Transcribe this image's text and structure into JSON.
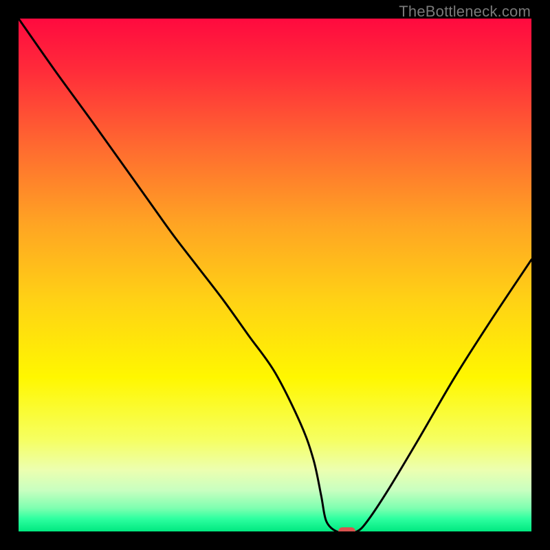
{
  "watermark": "TheBottleneck.com",
  "chart_data": {
    "type": "line",
    "title": "",
    "xlabel": "",
    "ylabel": "",
    "xlim": [
      0,
      100
    ],
    "ylim": [
      0,
      100
    ],
    "x": [
      0,
      7,
      15,
      25,
      30,
      35,
      40,
      45,
      50,
      55,
      57.5,
      59,
      60,
      62,
      64,
      66,
      68,
      72,
      78,
      85,
      92,
      100
    ],
    "values": [
      100,
      90,
      79,
      65,
      58,
      51.5,
      45,
      38,
      31,
      21,
      14,
      7,
      2,
      0,
      0,
      0,
      2,
      8,
      18,
      30,
      41,
      53
    ],
    "marker": {
      "x": 64,
      "y": 0,
      "color": "#d9534f",
      "w": 3.4,
      "h": 1.6
    },
    "gradient_stops": [
      {
        "pos": 0.0,
        "color": "#ff0a3f"
      },
      {
        "pos": 0.1,
        "color": "#ff2b3a"
      },
      {
        "pos": 0.25,
        "color": "#ff6a30"
      },
      {
        "pos": 0.4,
        "color": "#ffa423"
      },
      {
        "pos": 0.55,
        "color": "#ffd215"
      },
      {
        "pos": 0.7,
        "color": "#fff700"
      },
      {
        "pos": 0.82,
        "color": "#f6ff60"
      },
      {
        "pos": 0.88,
        "color": "#ecffb0"
      },
      {
        "pos": 0.92,
        "color": "#c8ffc0"
      },
      {
        "pos": 0.955,
        "color": "#7dffb0"
      },
      {
        "pos": 0.975,
        "color": "#2effa0"
      },
      {
        "pos": 1.0,
        "color": "#00e880"
      }
    ]
  }
}
